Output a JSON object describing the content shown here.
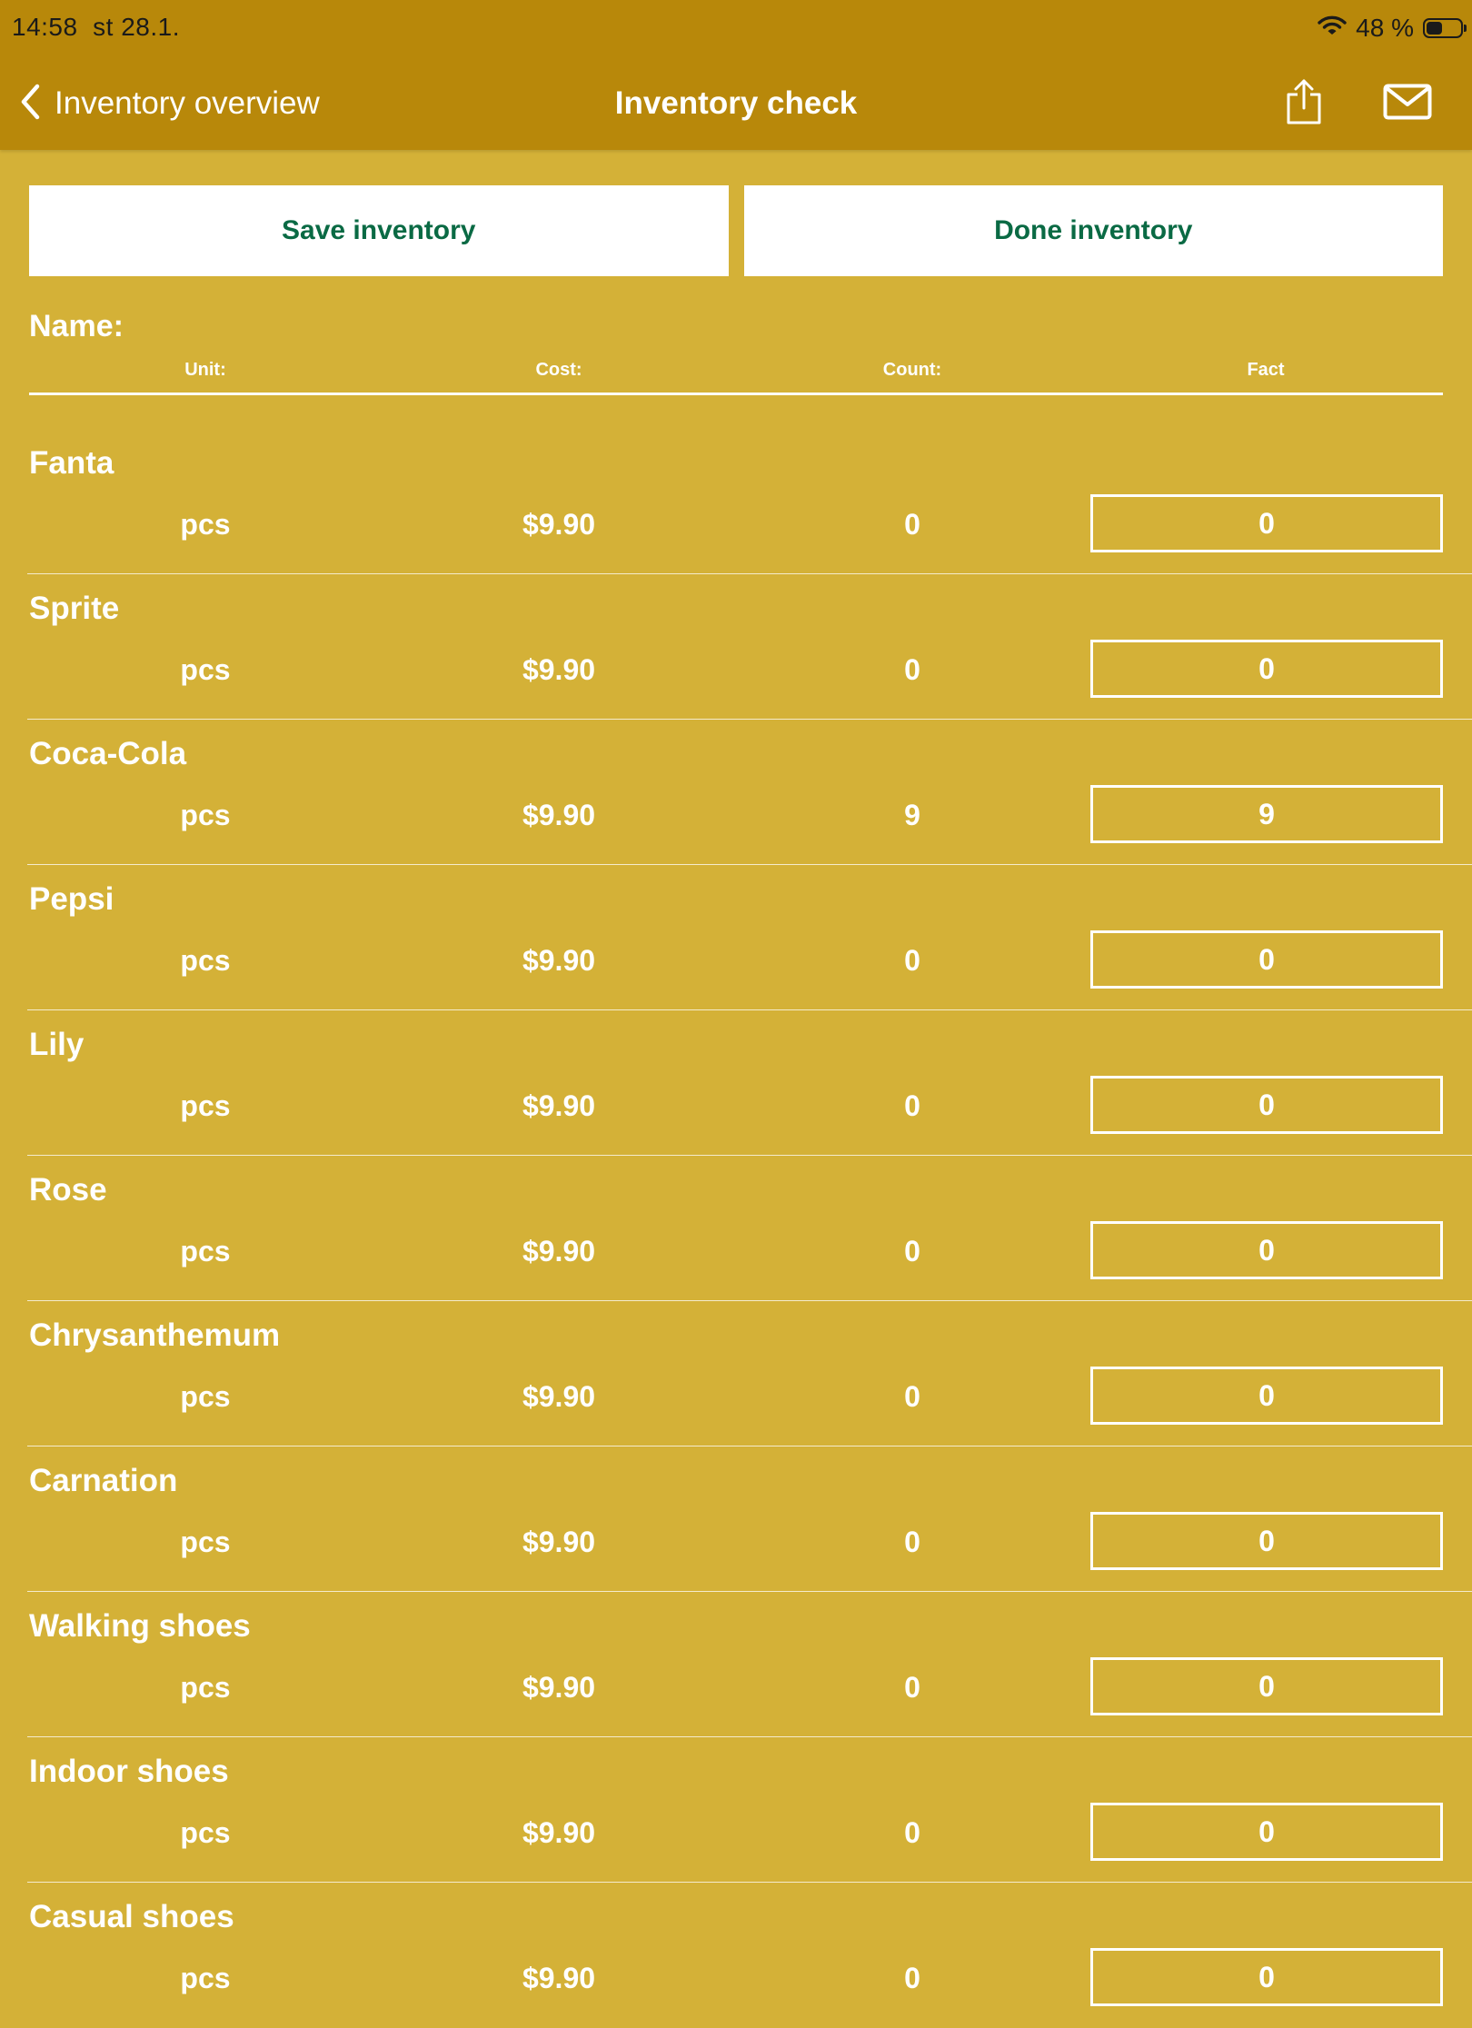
{
  "status_bar": {
    "time": "14:58",
    "date": "st 28.1.",
    "battery_text": "48 %",
    "battery_level": 0.48
  },
  "nav": {
    "back_label": "Inventory overview",
    "title": "Inventory check"
  },
  "actions": {
    "save_label": "Save inventory",
    "done_label": "Done inventory"
  },
  "columns": {
    "name": "Name:",
    "unit": "Unit:",
    "cost": "Cost:",
    "count": "Count:",
    "fact": "Fact"
  },
  "items": [
    {
      "name": "Fanta",
      "unit": "pcs",
      "cost": "$9.90",
      "count": "0",
      "fact": "0"
    },
    {
      "name": "Sprite",
      "unit": "pcs",
      "cost": "$9.90",
      "count": "0",
      "fact": "0"
    },
    {
      "name": "Coca-Cola",
      "unit": "pcs",
      "cost": "$9.90",
      "count": "9",
      "fact": "9"
    },
    {
      "name": "Pepsi",
      "unit": "pcs",
      "cost": "$9.90",
      "count": "0",
      "fact": "0"
    },
    {
      "name": "Lily",
      "unit": "pcs",
      "cost": "$9.90",
      "count": "0",
      "fact": "0"
    },
    {
      "name": "Rose",
      "unit": "pcs",
      "cost": "$9.90",
      "count": "0",
      "fact": "0"
    },
    {
      "name": "Chrysanthemum",
      "unit": "pcs",
      "cost": "$9.90",
      "count": "0",
      "fact": "0"
    },
    {
      "name": "Carnation",
      "unit": "pcs",
      "cost": "$9.90",
      "count": "0",
      "fact": "0"
    },
    {
      "name": "Walking shoes",
      "unit": "pcs",
      "cost": "$9.90",
      "count": "0",
      "fact": "0"
    },
    {
      "name": "Indoor shoes",
      "unit": "pcs",
      "cost": "$9.90",
      "count": "0",
      "fact": "0"
    },
    {
      "name": "Casual shoes",
      "unit": "pcs",
      "cost": "$9.90",
      "count": "0",
      "fact": "0"
    }
  ],
  "colors": {
    "background": "#d4b137",
    "topbar": "#b8880a",
    "button_text": "#0a6a44"
  }
}
